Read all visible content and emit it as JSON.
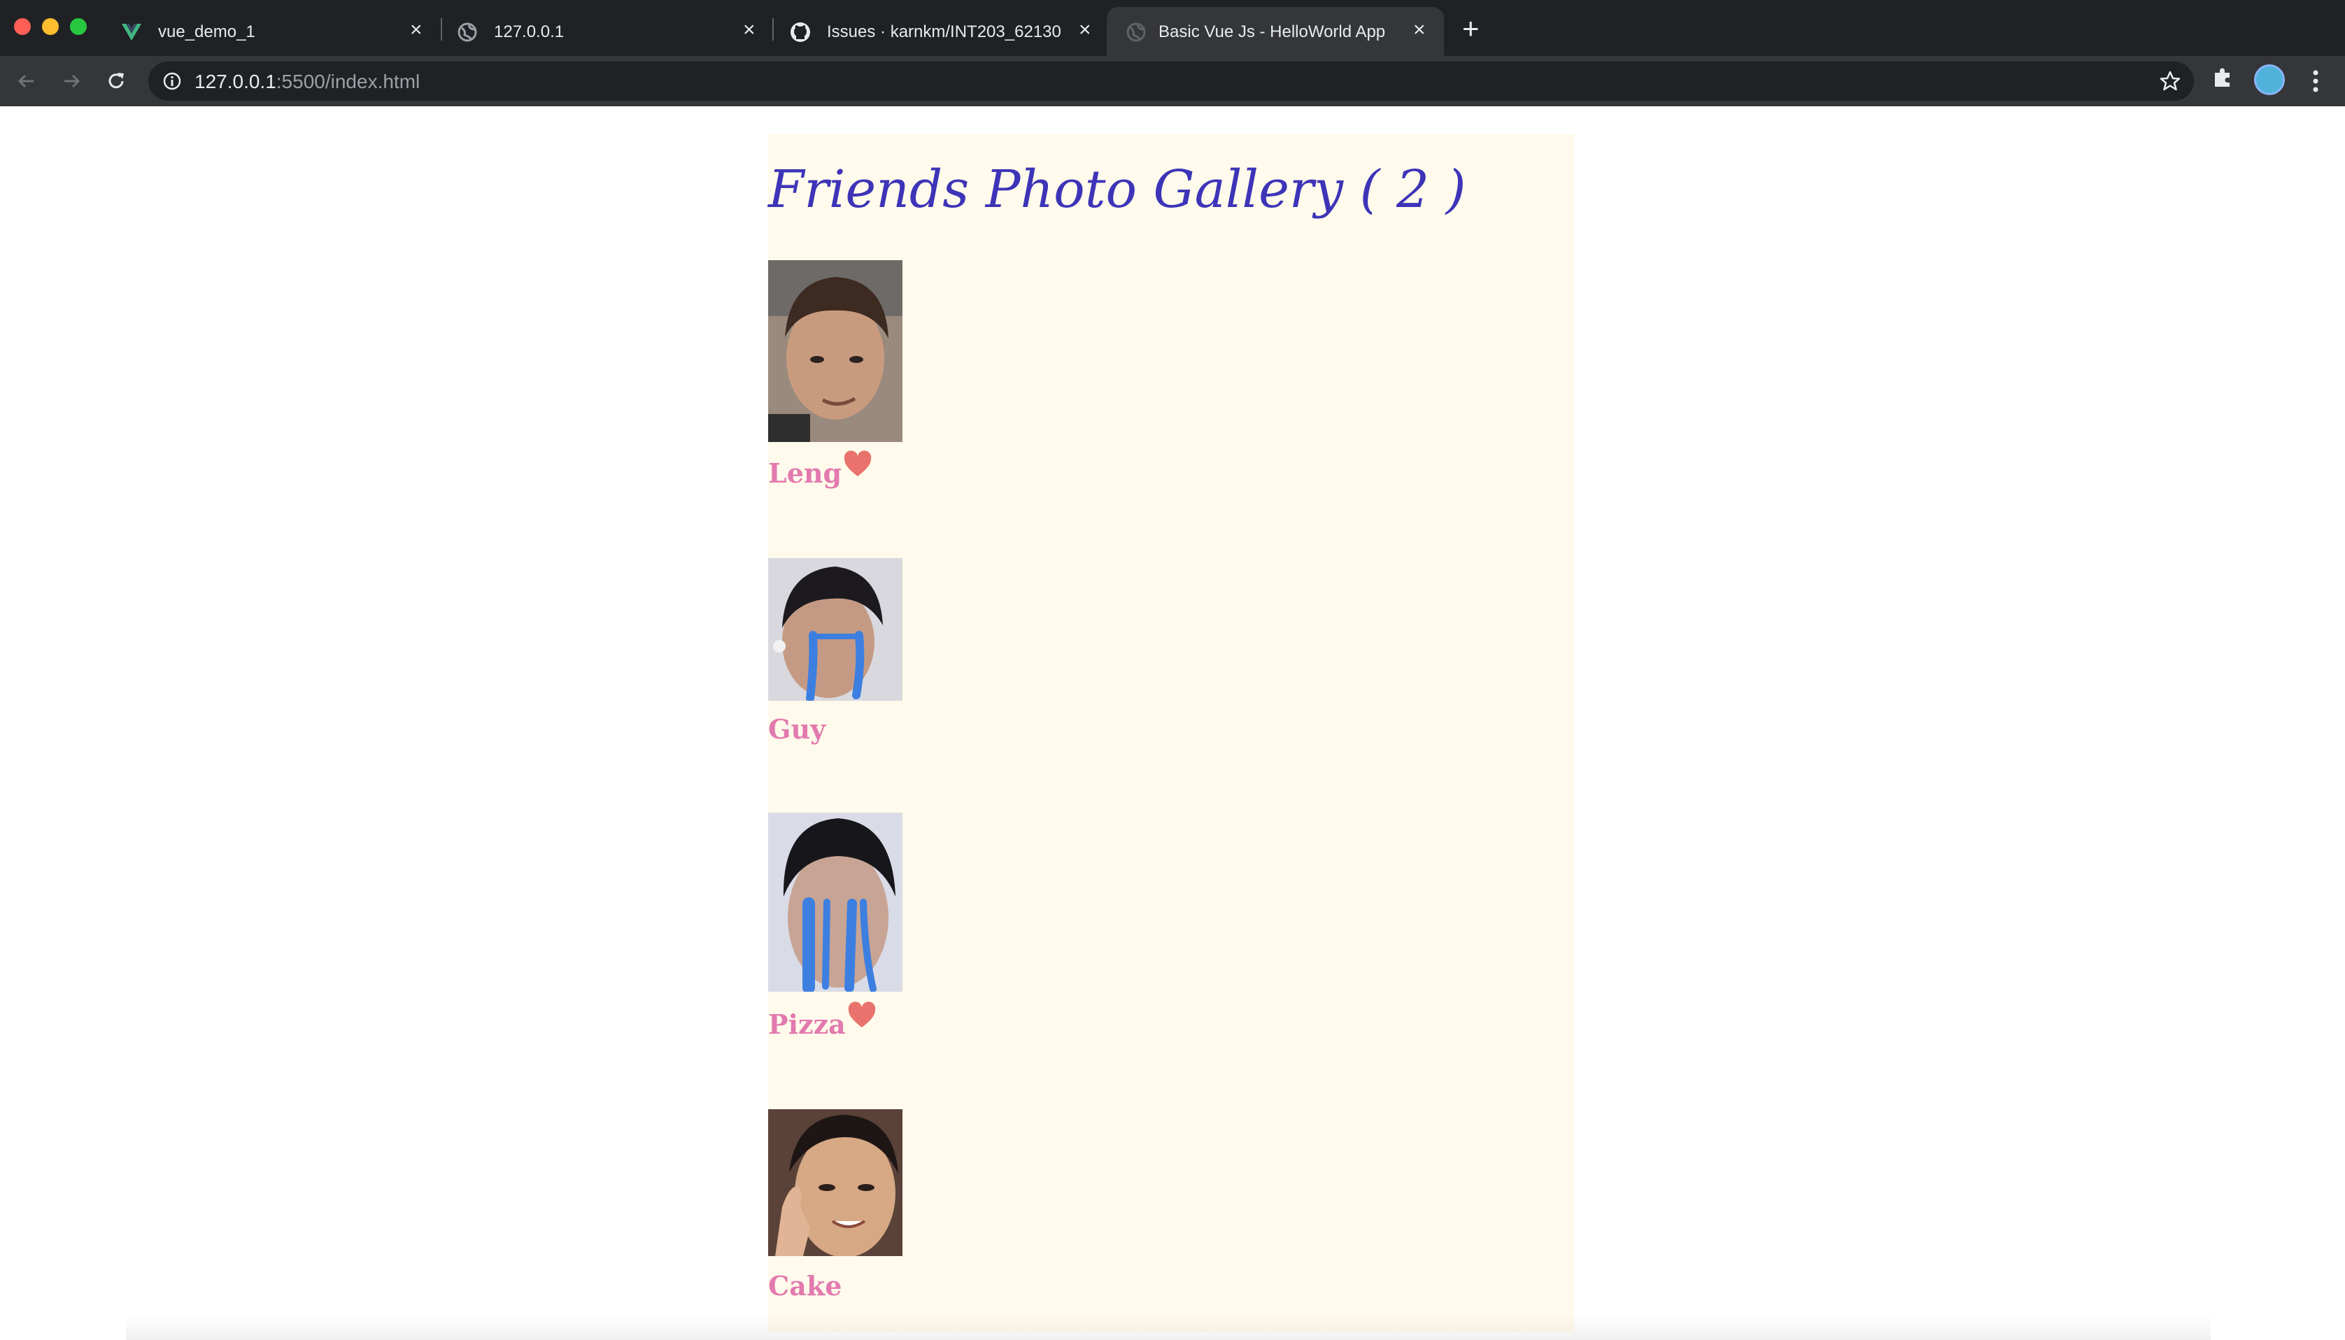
{
  "browser": {
    "tabs": [
      {
        "title": "vue_demo_1",
        "icon": "vue-logo-icon",
        "active": false
      },
      {
        "title": "127.0.0.1",
        "icon": "globe-icon",
        "active": false
      },
      {
        "title": "Issues · karnkm/INT203_62130",
        "icon": "github-icon",
        "active": false
      },
      {
        "title": "Basic Vue Js - HelloWorld App",
        "icon": "globe-icon",
        "active": true
      }
    ],
    "address": {
      "host": "127.0.0.1",
      "path": ":5500/index.html"
    }
  },
  "gallery": {
    "title": "Friends Photo Gallery ( 2 )",
    "friends": [
      {
        "name": "Leng",
        "favorite": true
      },
      {
        "name": "Guy",
        "favorite": false
      },
      {
        "name": "Pizza",
        "favorite": true
      },
      {
        "name": "Cake",
        "favorite": false
      }
    ]
  },
  "colors": {
    "title": "#3d34b8",
    "name": "#e27aaf",
    "heart": "#e9736c",
    "app_background": "#fffaeb"
  }
}
